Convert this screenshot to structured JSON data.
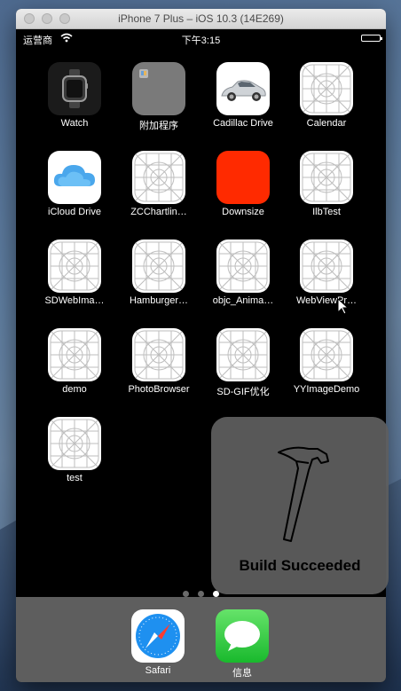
{
  "window": {
    "title": "iPhone 7 Plus – iOS 10.3 (14E269)"
  },
  "statusbar": {
    "carrier": "运营商",
    "time": "下午3:15"
  },
  "apps": [
    {
      "label": "Watch",
      "icon": "watch-icon"
    },
    {
      "label": "附加程序",
      "icon": "extras-folder-icon"
    },
    {
      "label": "Cadillac Drive",
      "icon": "cadillac-car-icon"
    },
    {
      "label": "Calendar",
      "icon": "placeholder-icon"
    },
    {
      "label": "iCloud Drive",
      "icon": "icloud-icon"
    },
    {
      "label": "ZCChartlin…",
      "icon": "placeholder-icon"
    },
    {
      "label": "Downsize",
      "icon": "red-square-icon"
    },
    {
      "label": "IlbTest",
      "icon": "placeholder-icon"
    },
    {
      "label": "SDWebIma…",
      "icon": "placeholder-icon"
    },
    {
      "label": "Hamburger…",
      "icon": "placeholder-icon"
    },
    {
      "label": "objc_Anima…",
      "icon": "placeholder-icon"
    },
    {
      "label": "WebViewPr…",
      "icon": "placeholder-icon"
    },
    {
      "label": "demo",
      "icon": "placeholder-icon"
    },
    {
      "label": "PhotoBrowser",
      "icon": "placeholder-icon"
    },
    {
      "label": "SD-GIF优化",
      "icon": "placeholder-icon"
    },
    {
      "label": "YYImageDemo",
      "icon": "placeholder-icon"
    },
    {
      "label": "test",
      "icon": "placeholder-icon"
    }
  ],
  "dock": [
    {
      "label": "Safari",
      "icon": "safari-icon"
    },
    {
      "label": "信息",
      "icon": "messages-icon"
    }
  ],
  "hud": {
    "text": "Build Succeeded",
    "icon": "hammer-icon"
  }
}
